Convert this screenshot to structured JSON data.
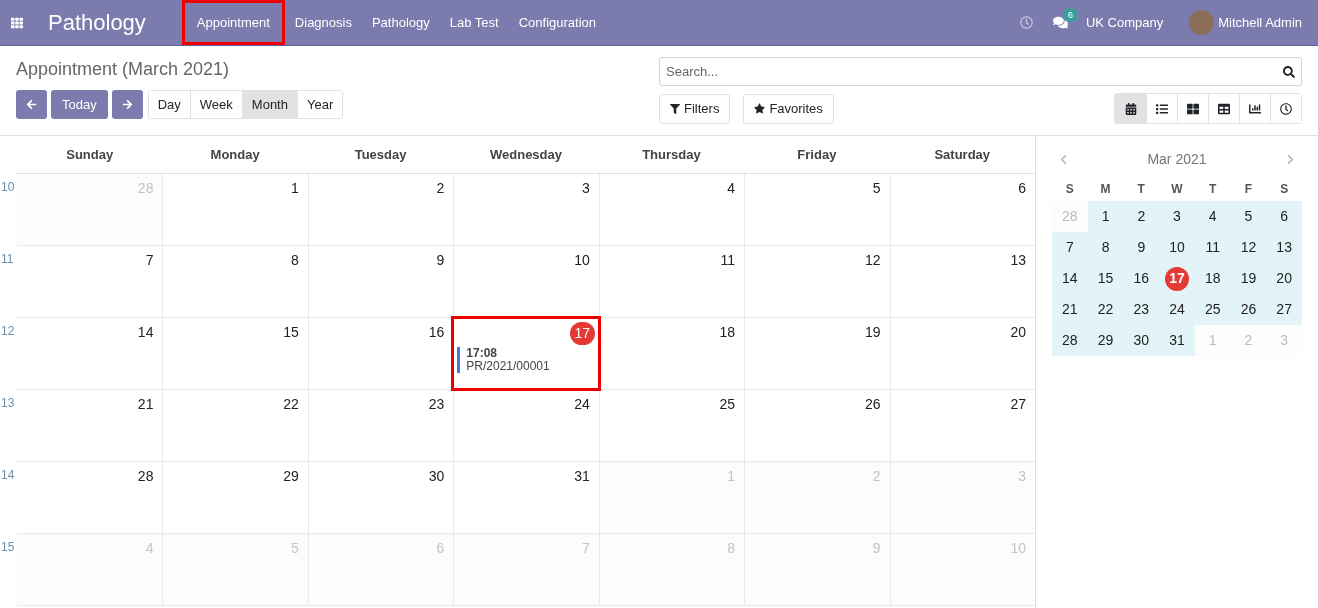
{
  "navbar": {
    "app_title": "Pathology",
    "menus": [
      {
        "label": "Appointment",
        "highlighted": true
      },
      {
        "label": "Diagnosis",
        "highlighted": false
      },
      {
        "label": "Pathology",
        "highlighted": false
      },
      {
        "label": "Lab Test",
        "highlighted": false
      },
      {
        "label": "Configuration",
        "highlighted": false
      }
    ],
    "message_count": "6",
    "company": "UK Company",
    "user": "Mitchell Admin"
  },
  "control_panel": {
    "title": "Appointment (March 2021)",
    "today_button": "Today",
    "scales": [
      {
        "label": "Day",
        "selected": false
      },
      {
        "label": "Week",
        "selected": false
      },
      {
        "label": "Month",
        "selected": true
      },
      {
        "label": "Year",
        "selected": false
      }
    ],
    "search": {
      "placeholder": "Search..."
    },
    "filters": "Filters",
    "favorites": "Favorites",
    "views": [
      {
        "kind": "calendar",
        "selected": true
      },
      {
        "kind": "list",
        "selected": false
      },
      {
        "kind": "kanban",
        "selected": false
      },
      {
        "kind": "pivot",
        "selected": false
      },
      {
        "kind": "graph",
        "selected": false
      },
      {
        "kind": "activity",
        "selected": false
      }
    ]
  },
  "calendar": {
    "weekdays": [
      "Sunday",
      "Monday",
      "Tuesday",
      "Wednesday",
      "Thursday",
      "Friday",
      "Saturday"
    ],
    "weeks": [
      {
        "number": "10",
        "days": [
          {
            "day": "28",
            "other_month": true
          },
          {
            "day": "1",
            "other_month": false
          },
          {
            "day": "2",
            "other_month": false
          },
          {
            "day": "3",
            "other_month": false
          },
          {
            "day": "4",
            "other_month": false
          },
          {
            "day": "5",
            "other_month": false
          },
          {
            "day": "6",
            "other_month": false
          }
        ]
      },
      {
        "number": "11",
        "days": [
          {
            "day": "7",
            "other_month": false
          },
          {
            "day": "8",
            "other_month": false
          },
          {
            "day": "9",
            "other_month": false
          },
          {
            "day": "10",
            "other_month": false
          },
          {
            "day": "11",
            "other_month": false
          },
          {
            "day": "12",
            "other_month": false
          },
          {
            "day": "13",
            "other_month": false
          }
        ]
      },
      {
        "number": "12",
        "days": [
          {
            "day": "14",
            "other_month": false
          },
          {
            "day": "15",
            "other_month": false
          },
          {
            "day": "16",
            "other_month": false
          },
          {
            "day": "17",
            "other_month": false,
            "today": true,
            "highlighted": true,
            "events": [
              {
                "time": "17:08",
                "name": "PR/2021/00001",
                "color": "#3c7fd6"
              }
            ]
          },
          {
            "day": "18",
            "other_month": false
          },
          {
            "day": "19",
            "other_month": false
          },
          {
            "day": "20",
            "other_month": false
          }
        ]
      },
      {
        "number": "13",
        "days": [
          {
            "day": "21",
            "other_month": false
          },
          {
            "day": "22",
            "other_month": false
          },
          {
            "day": "23",
            "other_month": false
          },
          {
            "day": "24",
            "other_month": false
          },
          {
            "day": "25",
            "other_month": false
          },
          {
            "day": "26",
            "other_month": false
          },
          {
            "day": "27",
            "other_month": false
          }
        ]
      },
      {
        "number": "14",
        "days": [
          {
            "day": "28",
            "other_month": false
          },
          {
            "day": "29",
            "other_month": false
          },
          {
            "day": "30",
            "other_month": false
          },
          {
            "day": "31",
            "other_month": false
          },
          {
            "day": "1",
            "other_month": true
          },
          {
            "day": "2",
            "other_month": true
          },
          {
            "day": "3",
            "other_month": true
          }
        ]
      },
      {
        "number": "15",
        "days": [
          {
            "day": "4",
            "other_month": true
          },
          {
            "day": "5",
            "other_month": true
          },
          {
            "day": "6",
            "other_month": true
          },
          {
            "day": "7",
            "other_month": true
          },
          {
            "day": "8",
            "other_month": true
          },
          {
            "day": "9",
            "other_month": true
          },
          {
            "day": "10",
            "other_month": true
          }
        ]
      }
    ]
  },
  "mini_calendar": {
    "title": "Mar 2021",
    "weekdays": [
      "S",
      "M",
      "T",
      "W",
      "T",
      "F",
      "S"
    ],
    "weeks": [
      [
        {
          "day": "28",
          "in_range": false,
          "other_month": true
        },
        {
          "day": "1",
          "in_range": true,
          "other_month": false
        },
        {
          "day": "2",
          "in_range": true,
          "other_month": false
        },
        {
          "day": "3",
          "in_range": true,
          "other_month": false
        },
        {
          "day": "4",
          "in_range": true,
          "other_month": false
        },
        {
          "day": "5",
          "in_range": true,
          "other_month": false
        },
        {
          "day": "6",
          "in_range": true,
          "other_month": false
        }
      ],
      [
        {
          "day": "7",
          "in_range": true,
          "other_month": false
        },
        {
          "day": "8",
          "in_range": true,
          "other_month": false
        },
        {
          "day": "9",
          "in_range": true,
          "other_month": false
        },
        {
          "day": "10",
          "in_range": true,
          "other_month": false
        },
        {
          "day": "11",
          "in_range": true,
          "other_month": false
        },
        {
          "day": "12",
          "in_range": true,
          "other_month": false
        },
        {
          "day": "13",
          "in_range": true,
          "other_month": false
        }
      ],
      [
        {
          "day": "14",
          "in_range": true,
          "other_month": false
        },
        {
          "day": "15",
          "in_range": true,
          "other_month": false
        },
        {
          "day": "16",
          "in_range": true,
          "other_month": false
        },
        {
          "day": "17",
          "in_range": true,
          "other_month": false,
          "today": true
        },
        {
          "day": "18",
          "in_range": true,
          "other_month": false
        },
        {
          "day": "19",
          "in_range": true,
          "other_month": false
        },
        {
          "day": "20",
          "in_range": true,
          "other_month": false
        }
      ],
      [
        {
          "day": "21",
          "in_range": true,
          "other_month": false
        },
        {
          "day": "22",
          "in_range": true,
          "other_month": false
        },
        {
          "day": "23",
          "in_range": true,
          "other_month": false
        },
        {
          "day": "24",
          "in_range": true,
          "other_month": false
        },
        {
          "day": "25",
          "in_range": true,
          "other_month": false
        },
        {
          "day": "26",
          "in_range": true,
          "other_month": false
        },
        {
          "day": "27",
          "in_range": true,
          "other_month": false
        }
      ],
      [
        {
          "day": "28",
          "in_range": true,
          "other_month": false
        },
        {
          "day": "29",
          "in_range": true,
          "other_month": false
        },
        {
          "day": "30",
          "in_range": true,
          "other_month": false
        },
        {
          "day": "31",
          "in_range": true,
          "other_month": false
        },
        {
          "day": "1",
          "in_range": false,
          "other_month": true
        },
        {
          "day": "2",
          "in_range": false,
          "other_month": true
        },
        {
          "day": "3",
          "in_range": false,
          "other_month": true
        }
      ]
    ]
  }
}
